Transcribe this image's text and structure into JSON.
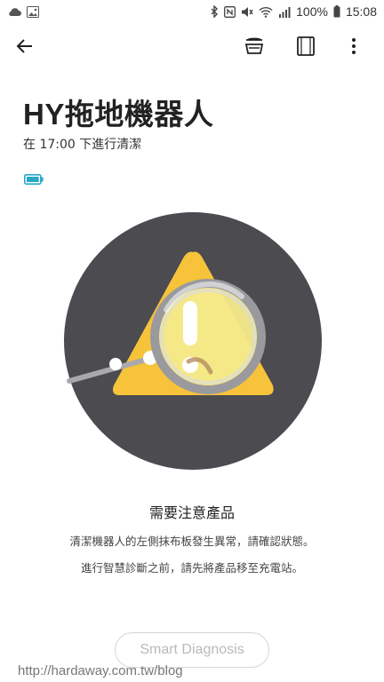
{
  "status_bar": {
    "left_icons": [
      "cloud-icon",
      "gallery-icon"
    ],
    "right_icons": [
      "bluetooth-icon",
      "nfc-icon",
      "mute-icon",
      "wifi-icon",
      "signal-icon",
      "battery-icon"
    ],
    "battery_percent": "100%",
    "time": "15:08"
  },
  "toolbar": {
    "back_icon": "arrow-left-icon",
    "action_icons": [
      "robot-mop-icon",
      "remote-panel-icon",
      "more-vert-icon"
    ]
  },
  "device": {
    "name": "HY拖地機器人",
    "schedule": "在 17:00 下進行清潔",
    "battery_icon": "battery-full-icon",
    "battery_color": "#27a7c9"
  },
  "hero": {
    "icon": "warning-magnifier-icon",
    "circle_color": "#4b4b50",
    "triangle_color": "#f6c33a"
  },
  "message": {
    "title": "需要注意產品",
    "line1": "清潔機器人的左側抹布板發生異常，請確認狀態。",
    "line2": "進行智慧診斷之前，請先將產品移至充電站。"
  },
  "actions": {
    "diagnosis_label": "Smart Diagnosis"
  },
  "watermark": "http://hardaway.com.tw/blog"
}
